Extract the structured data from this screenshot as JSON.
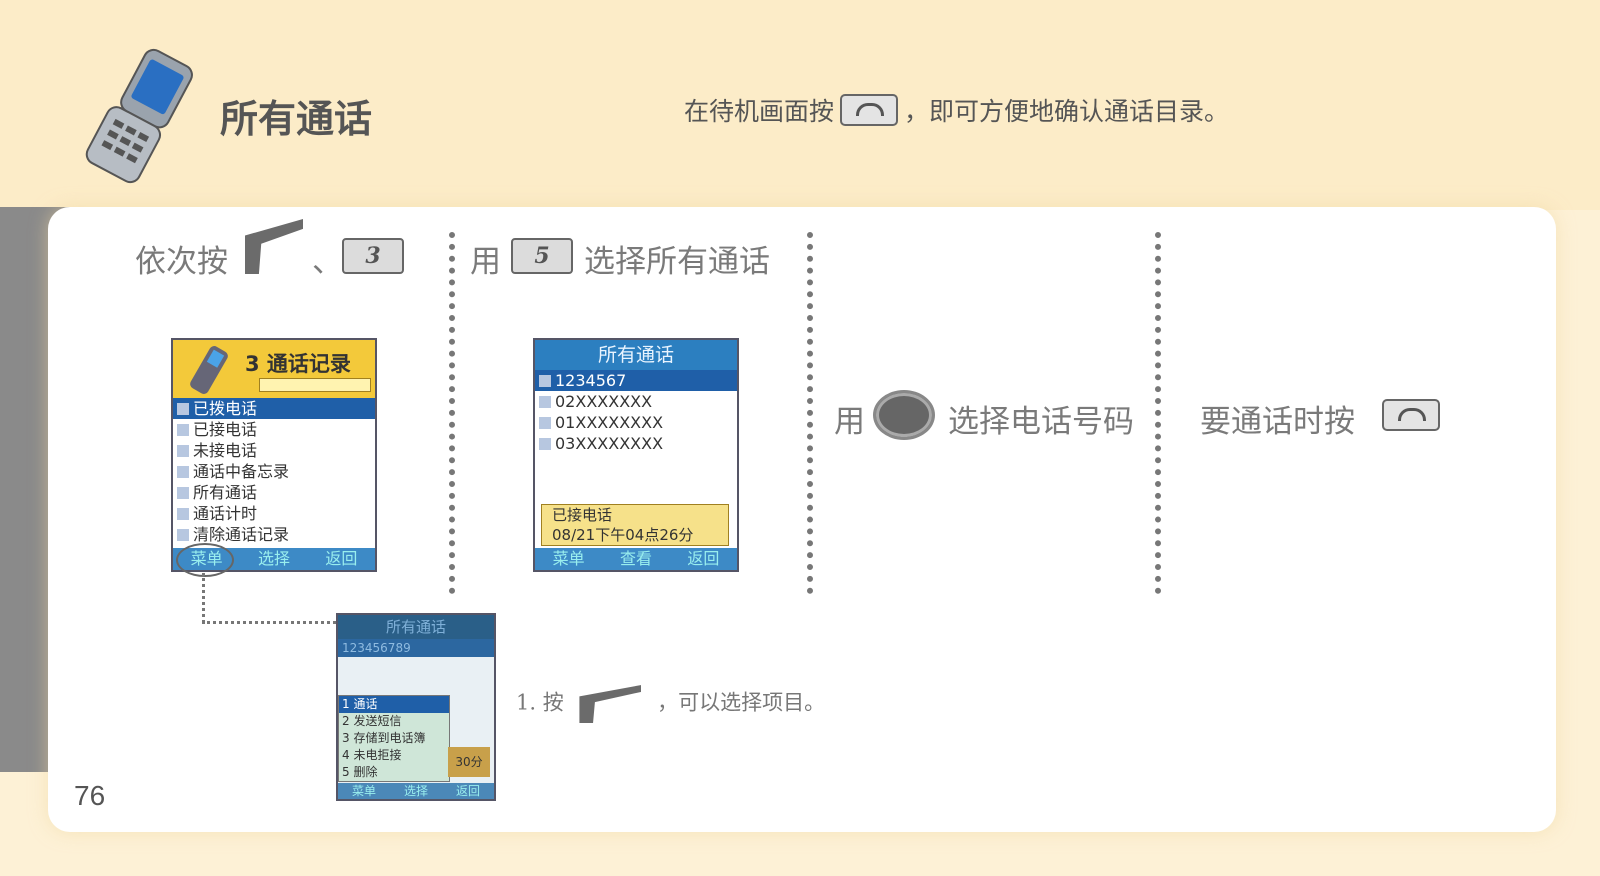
{
  "header": {
    "title": "所有通话",
    "intro_before": "在待机画面按",
    "intro_after": "，即可方便地确认通话目录。"
  },
  "steps": [
    {
      "text_before": "依次按",
      "sep": "、",
      "key2": "3"
    },
    {
      "text_before": "用",
      "key": "5",
      "text_after": "选择所有通话"
    },
    {
      "text_before": "用",
      "text_after": "选择电话号码"
    },
    {
      "text_before": "要通话时按"
    }
  ],
  "screen1": {
    "title": "3 通话记录",
    "items": [
      "已拨电话",
      "已接电话",
      "未接电话",
      "通话中备忘录",
      "所有通话",
      "通话计时",
      "清除通话记录"
    ],
    "softkeys": [
      "菜单",
      "选择",
      "返回"
    ]
  },
  "screen2": {
    "title": "所有通话",
    "items": [
      "1234567",
      "02XXXXXXX",
      "01XXXXXXXX",
      "03XXXXXXXX"
    ],
    "info_line1": "已接电话",
    "info_line2": "08/21下午04点26分",
    "softkeys": [
      "菜单",
      "查看",
      "返回"
    ]
  },
  "screen3": {
    "title": "所有通话",
    "number": "123456789",
    "menu": [
      "1 通话",
      "2 发送短信",
      "3 存储到电话簿",
      "4 未电拒接",
      "5 删除"
    ],
    "side_label": "30分",
    "softkeys": [
      "菜单",
      "选择",
      "返回"
    ]
  },
  "note": {
    "before": "1. 按",
    "after": "，可以选择项目。"
  },
  "page_number": "76",
  "colors": {
    "accent_yellow": "#f3c93a",
    "screen_blue": "#2c7fc0",
    "bg_cream": "#fdf1d6"
  }
}
